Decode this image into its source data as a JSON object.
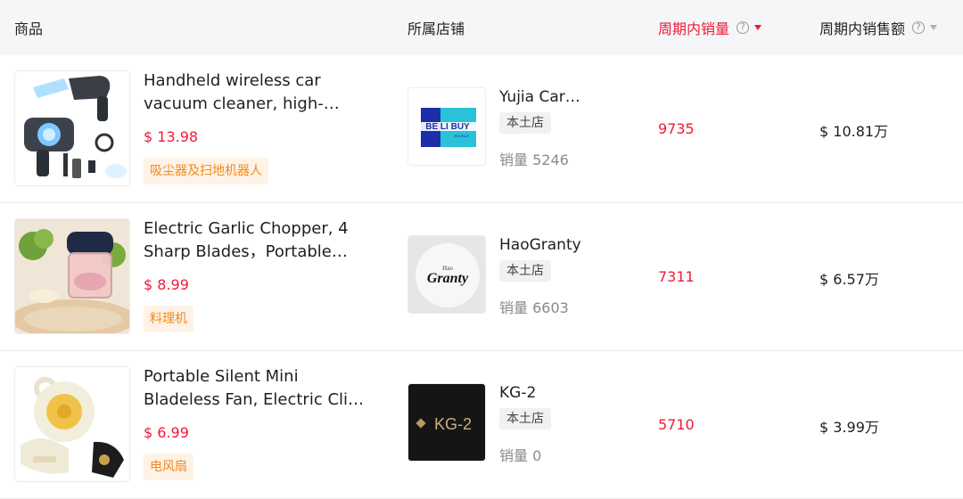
{
  "header": {
    "product": "商品",
    "store": "所属店铺",
    "period_sales": "周期内销量",
    "period_revenue": "周期内销售额",
    "help_glyph": "?"
  },
  "colors": {
    "accent_red": "#ef1b36",
    "tag_orange": "#f28a1a",
    "tag_bg": "#fff2e6"
  },
  "rows": [
    {
      "title": "Handheld wireless car vacuum cleaner, high-…",
      "price": "$ 13.98",
      "category": "吸尘器及扫地机器人",
      "store_name": "Yujia Car…",
      "store_tag": "本土店",
      "store_sales": "销量 5246",
      "logo_text_main": "BE LI BUY",
      "logo_text_sub": "BELIBUY",
      "sales": "9735",
      "amount": "$ 10.81万",
      "image_icon": "vacuum-cleaner-icon"
    },
    {
      "title": "Electric Garlic Chopper, 4 Sharp Blades，Portable…",
      "price": "$ 8.99",
      "category": "料理机",
      "store_name": "HaoGranty",
      "store_tag": "本土店",
      "store_sales": "销量 6603",
      "logo_text_main": "Granty",
      "logo_text_sub": "Hao",
      "sales": "7311",
      "amount": "$ 6.57万",
      "image_icon": "food-chopper-icon"
    },
    {
      "title": "Portable Silent Mini Bladeless Fan, Electric Cli…",
      "price": "$ 6.99",
      "category": "电风扇",
      "store_name": "KG-2",
      "store_tag": "本土店",
      "store_sales": "销量 0",
      "logo_text_main": "KG-2",
      "logo_text_sub": "",
      "sales": "5710",
      "amount": "$ 3.99万",
      "image_icon": "neck-fan-icon"
    }
  ]
}
